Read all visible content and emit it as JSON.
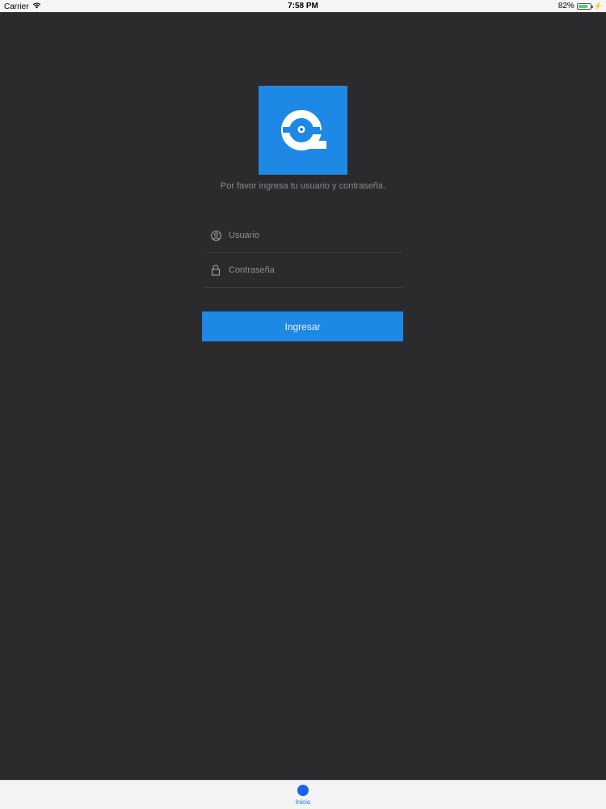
{
  "status_bar": {
    "carrier": "Carrier",
    "time": "7:58 PM",
    "battery_text": "82%",
    "battery_level": 0.82,
    "battery_color": "#4cd964"
  },
  "login": {
    "logo_icon": "q-logo-icon",
    "prompt": "Por favor ingresa tu usuario y contraseña.",
    "username": {
      "icon": "user-icon",
      "placeholder": "Usuario",
      "value": ""
    },
    "password": {
      "icon": "lock-icon",
      "placeholder": "Contraseña",
      "value": ""
    },
    "submit_label": "Ingresar",
    "accent_color": "#1e88e5",
    "background_color": "#2b2a2c"
  },
  "tab_bar": {
    "items": [
      {
        "label": "Inicio",
        "icon": "home-circle-icon",
        "selected": true
      }
    ]
  }
}
